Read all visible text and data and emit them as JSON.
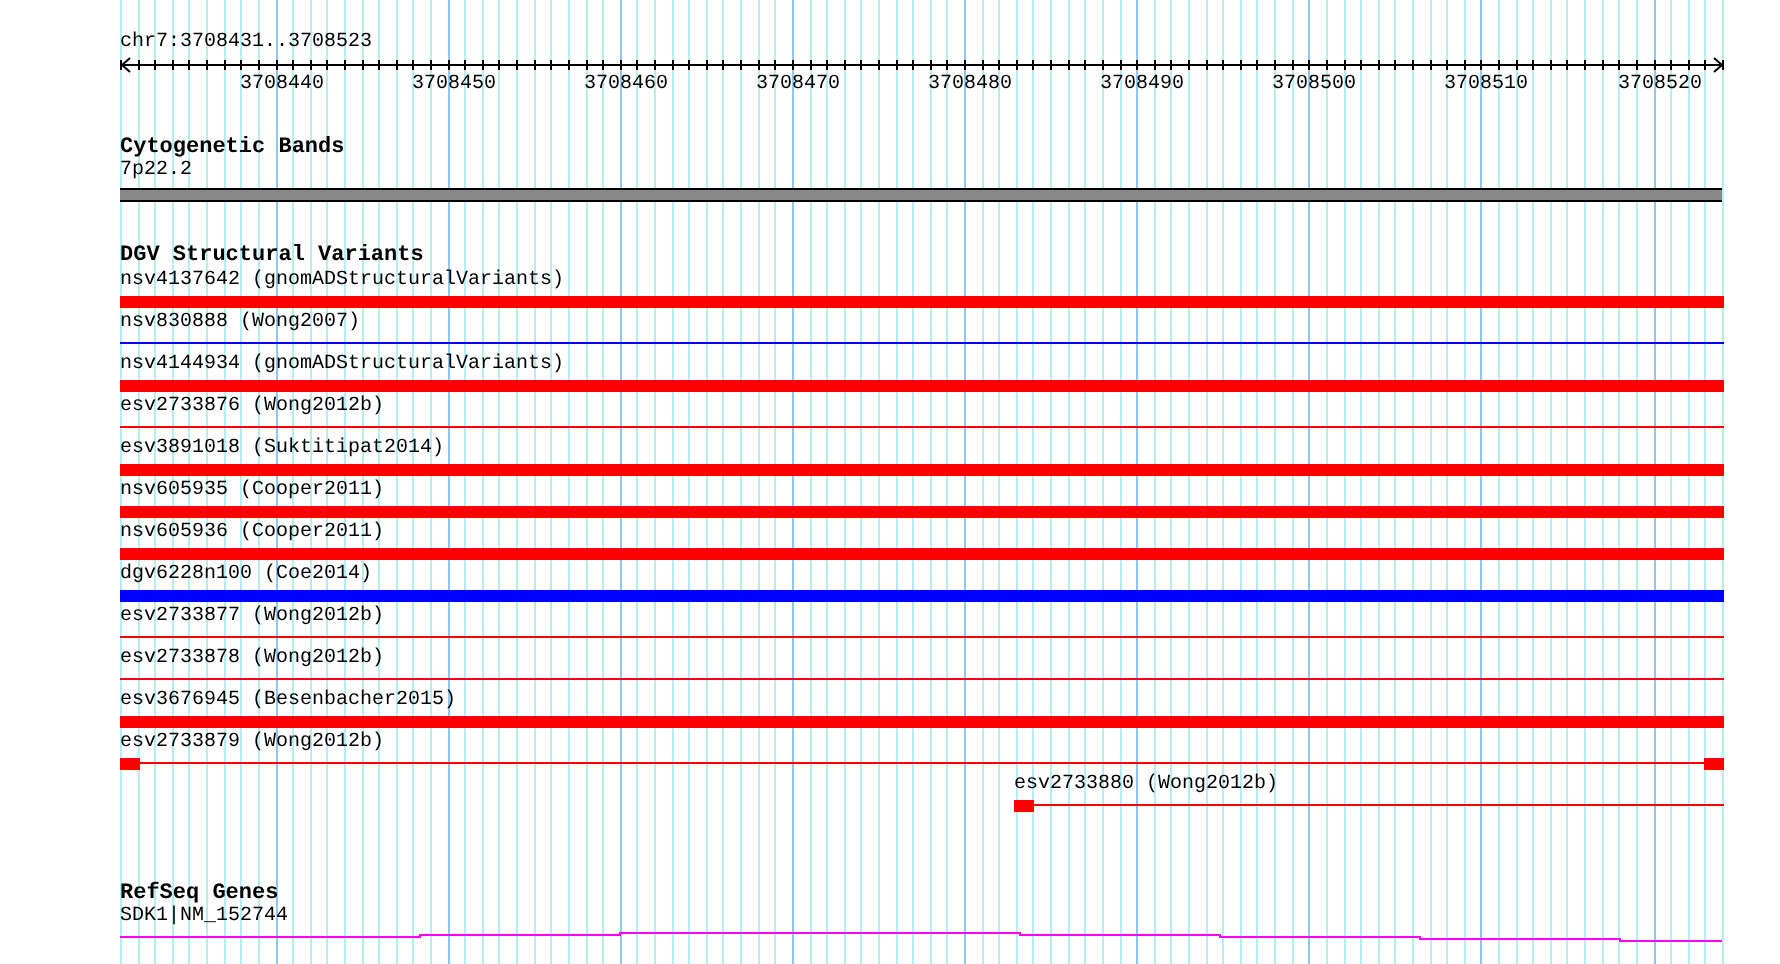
{
  "ruler": {
    "location": "chr7:3708431..3708523",
    "tick_labels": [
      "3708440",
      "3708450",
      "3708460",
      "3708470",
      "3708480",
      "3708490",
      "3708500",
      "3708510",
      "3708520"
    ]
  },
  "cytogenetic_bands": {
    "title": "Cytogenetic Bands",
    "band": "7p22.2"
  },
  "dgv_structural_variants": {
    "title": "DGV Structural Variants",
    "features": [
      {
        "label": "nsv4137642 (gnomADStructuralVariants)",
        "kind": "full",
        "thick": true,
        "color": "#ff0000"
      },
      {
        "label": "nsv830888 (Wong2007)",
        "kind": "full",
        "thick": false,
        "color": "#0000ff"
      },
      {
        "label": "nsv4144934 (gnomADStructuralVariants)",
        "kind": "full",
        "thick": true,
        "color": "#ff0000"
      },
      {
        "label": "esv2733876 (Wong2012b)",
        "kind": "full",
        "thick": false,
        "color": "#ff0000"
      },
      {
        "label": "esv3891018 (Suktitipat2014)",
        "kind": "full",
        "thick": true,
        "color": "#ff0000"
      },
      {
        "label": "nsv605935 (Cooper2011)",
        "kind": "full",
        "thick": true,
        "color": "#ff0000"
      },
      {
        "label": "nsv605936 (Cooper2011)",
        "kind": "full",
        "thick": true,
        "color": "#ff0000"
      },
      {
        "label": "dgv6228n100 (Coe2014)",
        "kind": "full",
        "thick": true,
        "color": "#0000ff"
      },
      {
        "label": "esv2733877 (Wong2012b)",
        "kind": "full",
        "thick": false,
        "color": "#ff0000"
      },
      {
        "label": "esv2733878 (Wong2012b)",
        "kind": "full",
        "thick": false,
        "color": "#ff0000"
      },
      {
        "label": "esv3676945 (Besenbacher2015)",
        "kind": "full",
        "thick": true,
        "color": "#ff0000"
      },
      {
        "label": "esv2733879 (Wong2012b)",
        "kind": "split",
        "thick": false,
        "color": "#ff0000"
      },
      {
        "label": "esv2733880 (Wong2012b)",
        "kind": "tail",
        "thick": false,
        "color": "#ff0000"
      }
    ]
  },
  "refseq_genes": {
    "title": "RefSeq Genes",
    "gene": "SDK1|NM_152744"
  }
}
